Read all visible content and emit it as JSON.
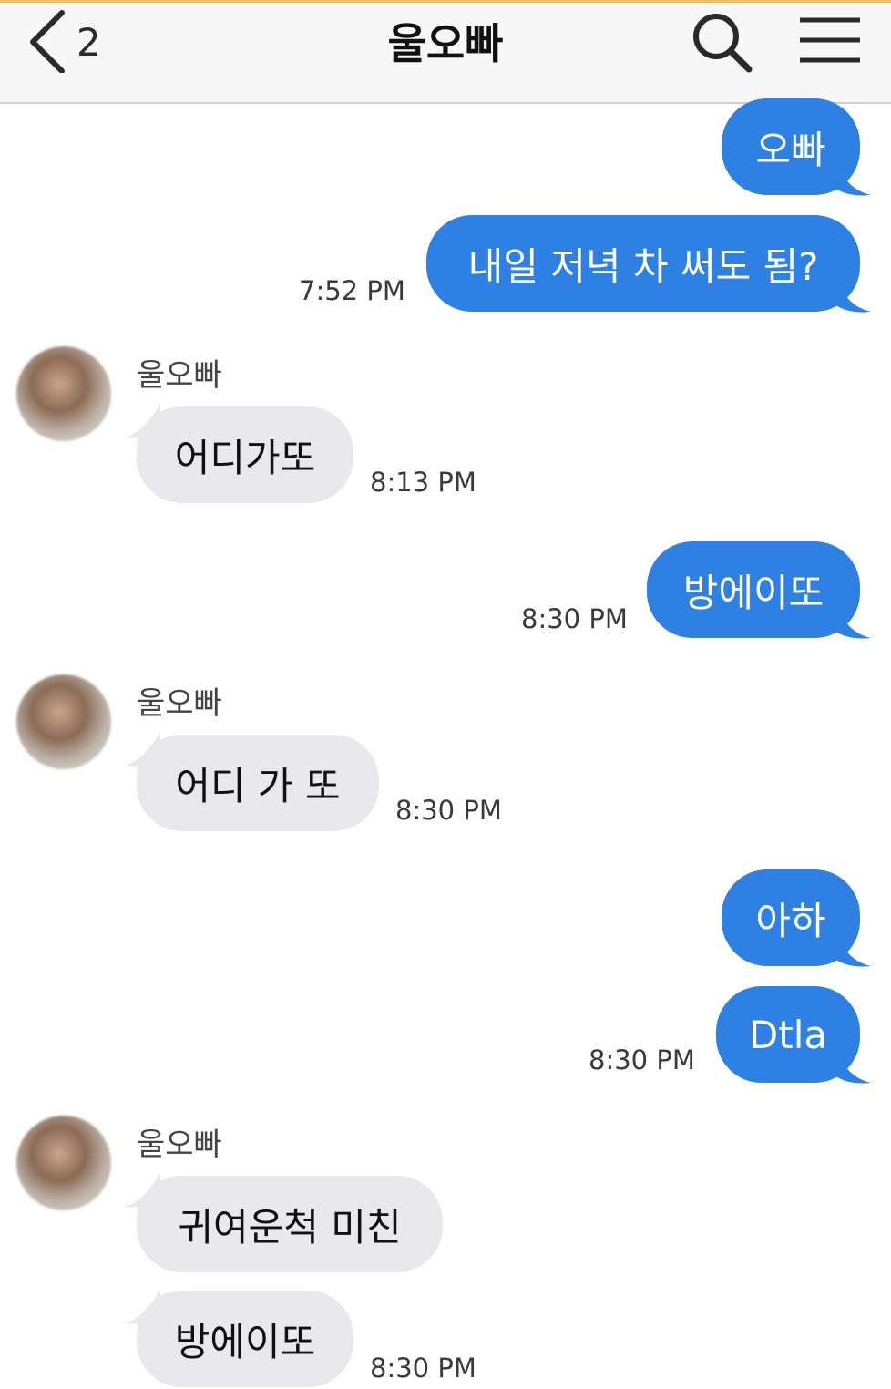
{
  "header": {
    "back_count": "2",
    "title": "울오빠"
  },
  "messages": [
    {
      "text": "오빠"
    },
    {
      "text": "내일 저녁 차 써도 됨?",
      "time": "7:52 PM"
    },
    {
      "sender": "울오빠",
      "text": "어디가또",
      "time": "8:13 PM"
    },
    {
      "text": "방에이또",
      "time": "8:30 PM"
    },
    {
      "sender": "울오빠",
      "text": "어디 가 또",
      "time": "8:30 PM"
    },
    {
      "text": "아하"
    },
    {
      "text": "Dtla",
      "time": "8:30 PM"
    },
    {
      "sender": "울오빠",
      "text": "귀여운척 미친"
    },
    {
      "text": "방에이또",
      "time": "8:30 PM"
    }
  ],
  "colors": {
    "sent_bubble": "#2f80e3",
    "received_bubble": "#e8e8ed",
    "header_bg": "#f7f7f7"
  },
  "icons": {
    "back": "chevron-left-icon",
    "search": "search-icon",
    "menu": "hamburger-menu-icon"
  }
}
